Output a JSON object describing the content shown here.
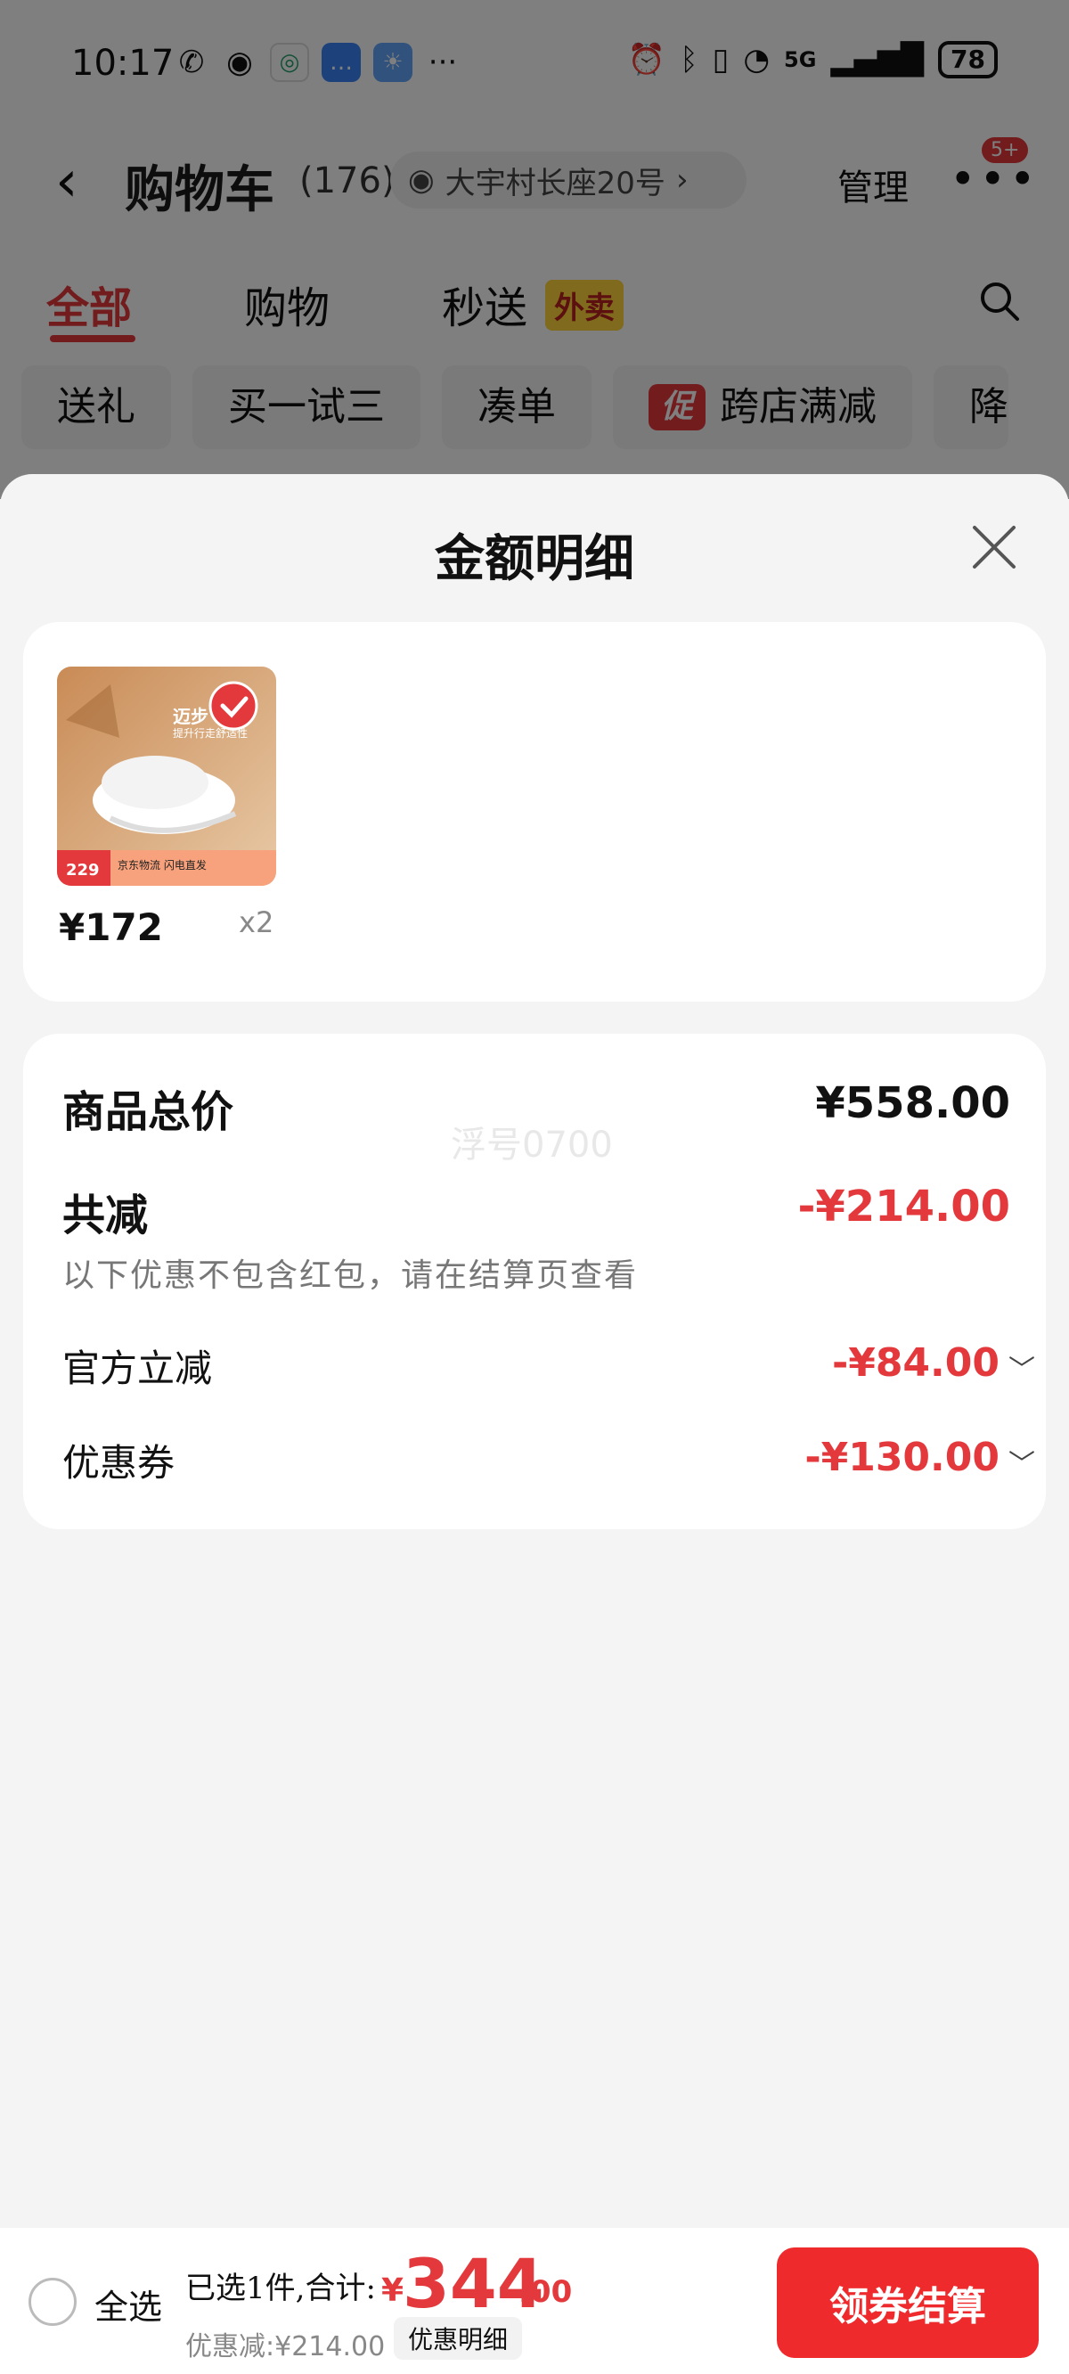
{
  "status_bar": {
    "time": "10:17",
    "battery": "78",
    "network": "5G"
  },
  "nav": {
    "title": "购物车",
    "count": "(176)",
    "address": "大宇村长座20号",
    "manage": "管理",
    "more_badge": "5+"
  },
  "tabs": [
    {
      "label": "全部"
    },
    {
      "label": "购物"
    },
    {
      "label": "秒送"
    }
  ],
  "tab_badge": "外卖",
  "chips": [
    {
      "label": "送礼"
    },
    {
      "label": "买一试三"
    },
    {
      "label": "凑单"
    },
    {
      "label": "跨店满减",
      "tag": "促"
    },
    {
      "label": "降"
    }
  ],
  "sheet": {
    "title": "金额明细",
    "goods": {
      "price": "¥172",
      "qty": "x2",
      "image_text": {
        "headline": "迈步",
        "subline": "提升行走舒适性",
        "price_badge": "229",
        "ship": "京东物流 闪电直发"
      }
    },
    "summary": {
      "total_label": "商品总价",
      "total_value": "¥558.00",
      "reduce_label": "共减",
      "reduce_value": "-¥214.00",
      "note": "以下优惠不包含红包，请在结算页查看",
      "official_label": "官方立减",
      "official_value": "-¥84.00",
      "coupon_label": "优惠券",
      "coupon_value": "-¥130.00",
      "watermark": "浮号0700"
    }
  },
  "bottom": {
    "select_all": "全选",
    "selected_text": "已选1件,合计:",
    "currency": "¥",
    "total_int": "344",
    "total_dec": ".00",
    "discount_text": "优惠减:¥214.00",
    "detail_label": "优惠明细",
    "checkout": "领券结算"
  },
  "colors": {
    "accent": "#e4393c",
    "checkout": "#ee2a2c",
    "sheet_bg": "#f4f4f4"
  }
}
